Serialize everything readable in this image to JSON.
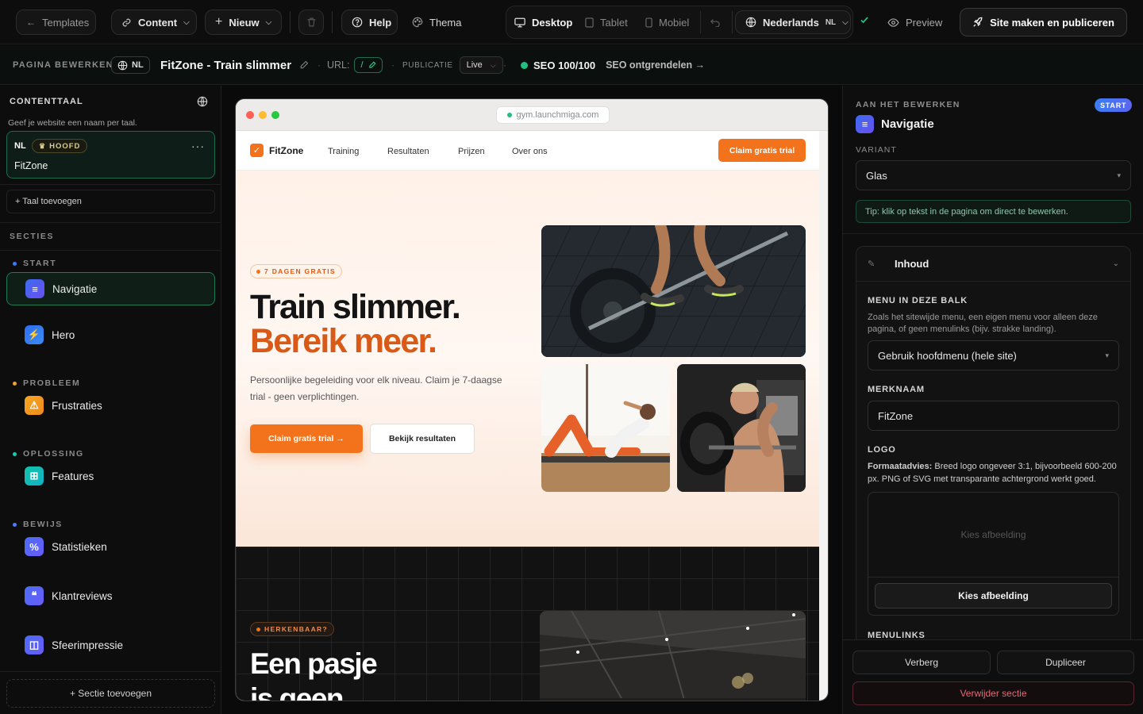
{
  "topbar": {
    "templates": "Templates",
    "content": "Content",
    "new": "Nieuw",
    "help": "Help",
    "theme": "Thema",
    "devices": [
      "Desktop",
      "Tablet",
      "Mobiel"
    ],
    "language": "Nederlands",
    "language_code": "NL",
    "preview": "Preview",
    "publish": "Site maken en publiceren"
  },
  "subbar": {
    "editing_label": "PAGINA BEWERKEN",
    "lang_code": "NL",
    "page_title": "FitZone - Train slimmer",
    "url_label": "URL:",
    "url_value": "/",
    "publication_label": "PUBLICATIE",
    "publication_value": "Live",
    "seo_score": "SEO 100/100",
    "seo_unlock": "SEO ontgrendelen →"
  },
  "left": {
    "content_lang_title": "CONTENTTAAL",
    "content_lang_hint": "Geef je website een naam per taal.",
    "lang_code": "NL",
    "main_badge": "HOOFD",
    "site_name": "FitZone",
    "add_language": "+ Taal toevoegen",
    "sections_title": "SECTIES",
    "groups": {
      "start": "START",
      "problem": "PROBLEEM",
      "solution": "OPLOSSING",
      "proof": "BEWIJS"
    },
    "items": {
      "nav": "Navigatie",
      "hero": "Hero",
      "frustrations": "Frustraties",
      "features": "Features",
      "stats": "Statistieken",
      "reviews": "Klantreviews",
      "impression": "Sfeerimpressie"
    },
    "add_section": "+ Sectie toevoegen"
  },
  "preview": {
    "address": "gym.launchmiga.com",
    "brand": "FitZone",
    "nav_links": [
      "Training",
      "Resultaten",
      "Prijzen",
      "Over ons"
    ],
    "nav_cta": "Claim gratis trial",
    "hero_tag": "7 DAGEN GRATIS",
    "hero_title_1": "Train slimmer.",
    "hero_title_2": "Bereik meer.",
    "hero_text": "Persoonlijke begeleiding voor elk niveau. Claim je 7-daagse trial - geen verplichtingen.",
    "hero_cta_primary": "Claim gratis trial →",
    "hero_cta_secondary": "Bekijk resultaten",
    "section2_tag": "HERKENBAAR?",
    "section2_title_1": "Een pasje",
    "section2_title_2": "is geen"
  },
  "right": {
    "editing_label": "AAN HET BEWERKEN",
    "start_badge": "START",
    "section_name": "Navigatie",
    "variant_label": "VARIANT",
    "variant_value": "Glas",
    "tip": "Tip: klik op tekst in de pagina om direct te bewerken.",
    "content_header": "Inhoud",
    "menu_label": "MENU IN DEZE BALK",
    "menu_help": "Zoals het sitewijde menu, een eigen menu voor alleen deze pagina, of geen menulinks (bijv. strakke landing).",
    "menu_value": "Gebruik hoofdmenu (hele site)",
    "brand_label": "MERKNAAM",
    "brand_value": "FitZone",
    "logo_label": "LOGO",
    "logo_advice_bold": "Formaatadvies:",
    "logo_advice": " Breed logo ongeveer 3:1, bijvoorbeeld 600-200 px. PNG of SVG met transparante achtergrond werkt goed.",
    "logo_placeholder": "Kies afbeelding",
    "logo_button": "Kies afbeelding",
    "menulinks_label": "MENULINKS",
    "hide": "Verberg",
    "duplicate": "Dupliceer",
    "delete": "Verwijder sectie"
  },
  "colors": {
    "accent_green": "#22c07f",
    "brand_orange": "#f2731c",
    "start_badge": "#3d7bf0"
  }
}
